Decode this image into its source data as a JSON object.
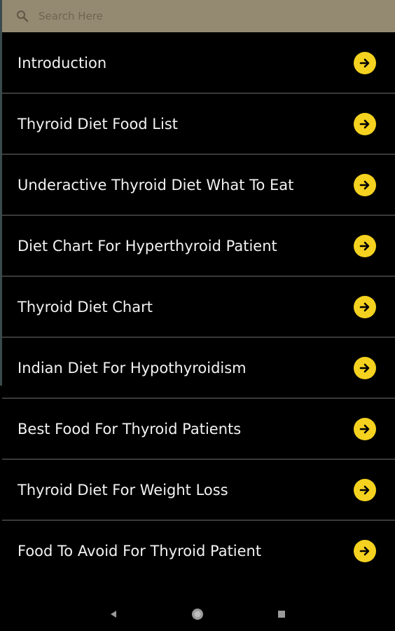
{
  "search": {
    "placeholder": "Search Here",
    "icon": "search-icon"
  },
  "colors": {
    "search_bar_bg": "#948a72",
    "arrow_button": "#f4d21f",
    "background": "#000000",
    "divider": "#3a3a3a",
    "item_text": "#f2f2f2"
  },
  "list": {
    "items": [
      {
        "label": "Introduction"
      },
      {
        "label": "Thyroid Diet Food List"
      },
      {
        "label": "Underactive Thyroid Diet What To Eat"
      },
      {
        "label": "Diet Chart For Hyperthyroid Patient"
      },
      {
        "label": "Thyroid Diet Chart"
      },
      {
        "label": "Indian Diet For Hypothyroidism"
      },
      {
        "label": "Best Food For Thyroid Patients"
      },
      {
        "label": "Thyroid Diet For Weight Loss"
      },
      {
        "label": "Food To Avoid For Thyroid Patient"
      }
    ],
    "item_icon": "arrow-right-circle-icon"
  },
  "nav": {
    "icons": [
      "back-icon",
      "home-icon",
      "recents-icon"
    ]
  }
}
